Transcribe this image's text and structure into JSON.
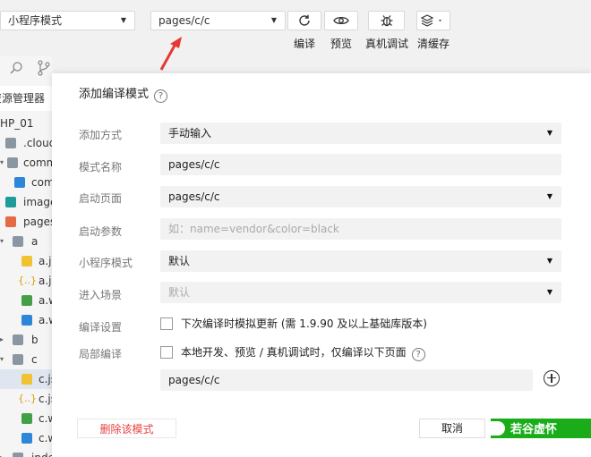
{
  "toolbar": {
    "mode_select": "小程序模式",
    "compile_select": "pages/c/c",
    "buttons": {
      "compile": "编译",
      "preview": "预览",
      "remote_debug": "真机调试",
      "clear_cache": "清缓存"
    }
  },
  "sidebar": {
    "tab_label": "资源管理器",
    "project": "HP_01",
    "tree": [
      {
        "label": ".cloud",
        "icon": "folder-icon"
      },
      {
        "label": "comm",
        "icon": "folder-icon"
      },
      {
        "label": "com",
        "icon": "css-file-icon"
      },
      {
        "label": "image",
        "icon": "image-folder-icon"
      },
      {
        "label": "pages",
        "icon": "pages-folder-icon"
      },
      {
        "label": "a",
        "icon": "folder-icon"
      },
      {
        "label": "a.js",
        "icon": "js-file-icon"
      },
      {
        "label": "a.js",
        "icon": "json-file-icon"
      },
      {
        "label": "a.w",
        "icon": "wxml-file-icon"
      },
      {
        "label": "a.w",
        "icon": "wxss-file-icon"
      },
      {
        "label": "b",
        "icon": "folder-icon"
      },
      {
        "label": "c",
        "icon": "folder-icon"
      },
      {
        "label": "c.js",
        "icon": "js-file-icon"
      },
      {
        "label": "c.js",
        "icon": "json-file-icon"
      },
      {
        "label": "c.w",
        "icon": "wxml-file-icon"
      },
      {
        "label": "c.w",
        "icon": "wxss-file-icon"
      },
      {
        "label": "index",
        "icon": "folder-icon"
      }
    ]
  },
  "dialog": {
    "title": "添加编译模式",
    "fields": {
      "add_method": {
        "label": "添加方式",
        "value": "手动输入"
      },
      "mode_name": {
        "label": "模式名称",
        "value": "pages/c/c"
      },
      "start_page": {
        "label": "启动页面",
        "value": "pages/c/c"
      },
      "start_params": {
        "label": "启动参数",
        "placeholder": "如：name=vendor&color=black"
      },
      "mini_mode": {
        "label": "小程序模式",
        "value": "默认"
      },
      "scene": {
        "label": "进入场景",
        "placeholder": "默认"
      },
      "compile_settings": {
        "label": "编译设置",
        "checkbox_text": "下次编译时模拟更新 (需 1.9.90 及以上基础库版本)"
      },
      "partial_compile": {
        "label": "局部编译",
        "checkbox_text": "本地开发、预览 / 真机调试时，仅编译以下页面",
        "page": "pages/c/c"
      }
    },
    "buttons": {
      "delete": "删除该模式",
      "cancel": "取消"
    },
    "watermark": "若谷虚怀"
  },
  "colors": {
    "accent_green": "#1aad19",
    "danger_red": "#e64340",
    "arrow_red": "#e53935"
  }
}
